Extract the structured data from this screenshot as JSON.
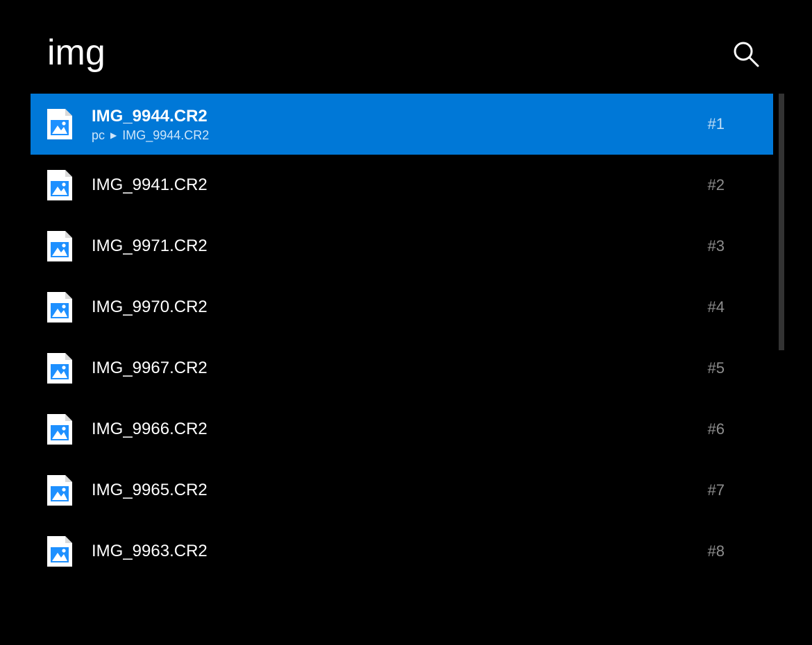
{
  "search": {
    "query": "img"
  },
  "results": [
    {
      "filename": "IMG_9944.CR2",
      "path_root": "pc",
      "path_leaf": "IMG_9944.CR2",
      "rank": "#1",
      "selected": true
    },
    {
      "filename": "IMG_9941.CR2",
      "rank": "#2",
      "selected": false
    },
    {
      "filename": "IMG_9971.CR2",
      "rank": "#3",
      "selected": false
    },
    {
      "filename": "IMG_9970.CR2",
      "rank": "#4",
      "selected": false
    },
    {
      "filename": "IMG_9967.CR2",
      "rank": "#5",
      "selected": false
    },
    {
      "filename": "IMG_9966.CR2",
      "rank": "#6",
      "selected": false
    },
    {
      "filename": "IMG_9965.CR2",
      "rank": "#7",
      "selected": false
    },
    {
      "filename": "IMG_9963.CR2",
      "rank": "#8",
      "selected": false
    }
  ],
  "colors": {
    "selection": "#0078d7",
    "background": "#000000",
    "text": "#ffffff",
    "rank": "rgba(255,255,255,0.55)"
  }
}
